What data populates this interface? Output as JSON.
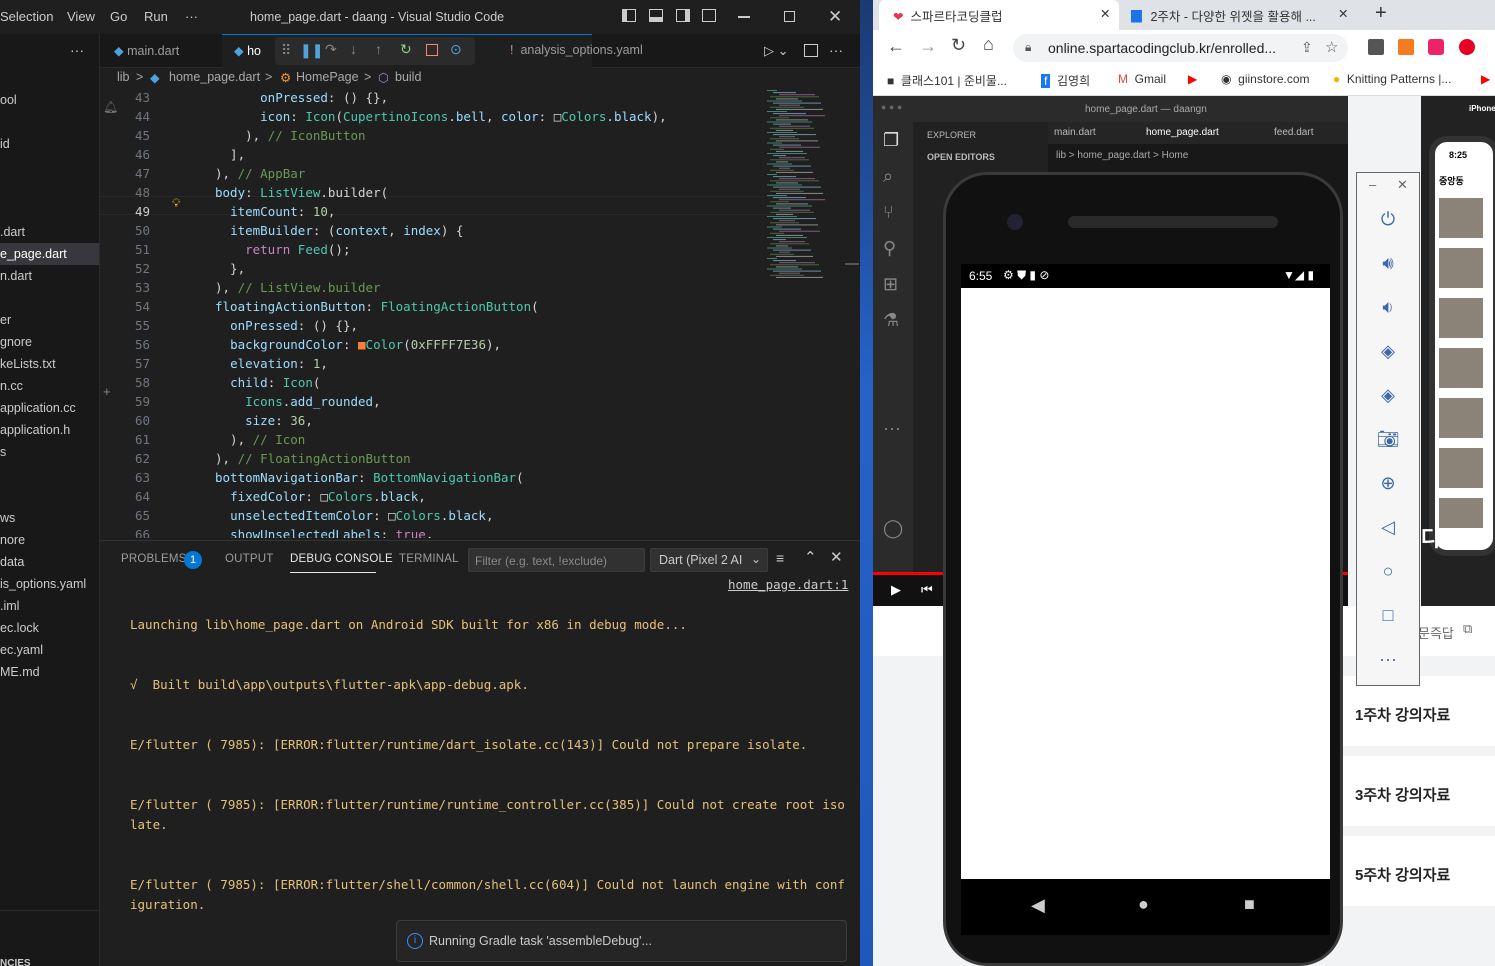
{
  "vscode": {
    "menu": [
      "Selection",
      "View",
      "Go",
      "Run",
      "···"
    ],
    "window_title": "home_page.dart - daang - Visual Studio Code",
    "sidebar_items": [
      "ool",
      "id",
      ".dart",
      "e_page.dart",
      "n.dart",
      "er",
      "gnore",
      "keLists.txt",
      "n.cc",
      "application.cc",
      "application.h",
      "s",
      "ws",
      "nore",
      "data",
      "is_options.yaml",
      ".iml",
      "ec.lock",
      "ec.yaml",
      "ME.md",
      "NCIES"
    ],
    "tabs": [
      "main.dart",
      "ho",
      "analysis_options.yaml"
    ],
    "breadcrumb": [
      "lib",
      ">",
      "home_page.dart",
      ">",
      "HomePage",
      ">",
      "build"
    ],
    "line_numbers": [
      "43",
      "44",
      "45",
      "46",
      "47",
      "48",
      "49",
      "50",
      "51",
      "52",
      "53",
      "54",
      "55",
      "56",
      "57",
      "58",
      "59",
      "60",
      "61",
      "62",
      "63",
      "64",
      "65",
      "66"
    ],
    "code_lines": [
      "      onPressed: () {},",
      "      icon: Icon(CupertinoIcons.bell, color: □Colors.black),",
      "    ), // IconButton",
      "  ],",
      "), // AppBar",
      "body: ListView.builder(",
      "  itemCount: 10,",
      "  itemBuilder: (context, index) {",
      "    return Feed();",
      "  },",
      "), // ListView.builder",
      "floatingActionButton: FloatingActionButton(",
      "  onPressed: () {},",
      "  backgroundColor: ■Color(0xFFFF7E36),",
      "  elevation: 1,",
      "  child: Icon(",
      "    Icons.add_rounded,",
      "    size: 36,",
      "  ), // Icon",
      "), // FloatingActionButton",
      "bottomNavigationBar: BottomNavigationBar(",
      "  fixedColor: □Colors.black,",
      "  unselectedItemColor: □Colors.black,",
      "  showUnselectedLabels: true,"
    ],
    "panel_tabs": [
      "PROBLEMS",
      "OUTPUT",
      "DEBUG CONSOLE",
      "TERMINAL"
    ],
    "problems_count": "1",
    "filter_placeholder": "Filter (e.g. text, !exclude)",
    "debug_target": "Dart (Pixel 2 AI",
    "console_link": "home_page.dart:1",
    "console_lines": [
      "Launching lib\\home_page.dart on Android SDK built for x86 in debug mode...",
      "√  Built build\\app\\outputs\\flutter-apk\\app-debug.apk.",
      "E/flutter ( 7985): [ERROR:flutter/runtime/dart_isolate.cc(143)] Could not prepare isolate.",
      "E/flutter ( 7985): [ERROR:flutter/runtime/runtime_controller.cc(385)] Could not create root isolate.",
      "E/flutter ( 7985): [ERROR:flutter/shell/common/shell.cc(604)] Could not launch engine with configuration."
    ],
    "toast": "Running Gradle task 'assembleDebug'..."
  },
  "chrome": {
    "tabs": [
      "스파르타코딩클럽",
      "2주차 - 다양한 위젯을 활용해 ..."
    ],
    "url": "online.spartacodingclub.kr/enrolled...",
    "bookmarks": [
      "클래스101 | 준비물...",
      "김영희",
      "Gmail",
      "giinstore.com",
      "Knitting Patterns |..."
    ],
    "embed_title": "home_page.dart — daangn",
    "embed_tabs": [
      "main.dart",
      "home_page.dart",
      "feed.dart"
    ],
    "embed_explorer": "EXPLORER",
    "embed_open_editors": "OPEN EDITORS",
    "embed_breadcrumb": "lib > home_page.dart > Home",
    "lectures": [
      "1주차 강의자료",
      "3주차 강의자료",
      "5주차 강의자료"
    ],
    "faq_link": "문즉답",
    "iphone_label": "iPhone",
    "iphone_time": "8:25",
    "iphone_location": "중앙동"
  },
  "emulator": {
    "time": "6:55"
  },
  "colors": {
    "accent": "#0078d4",
    "error": "#e5c07b",
    "orange": "#FF7E36"
  }
}
